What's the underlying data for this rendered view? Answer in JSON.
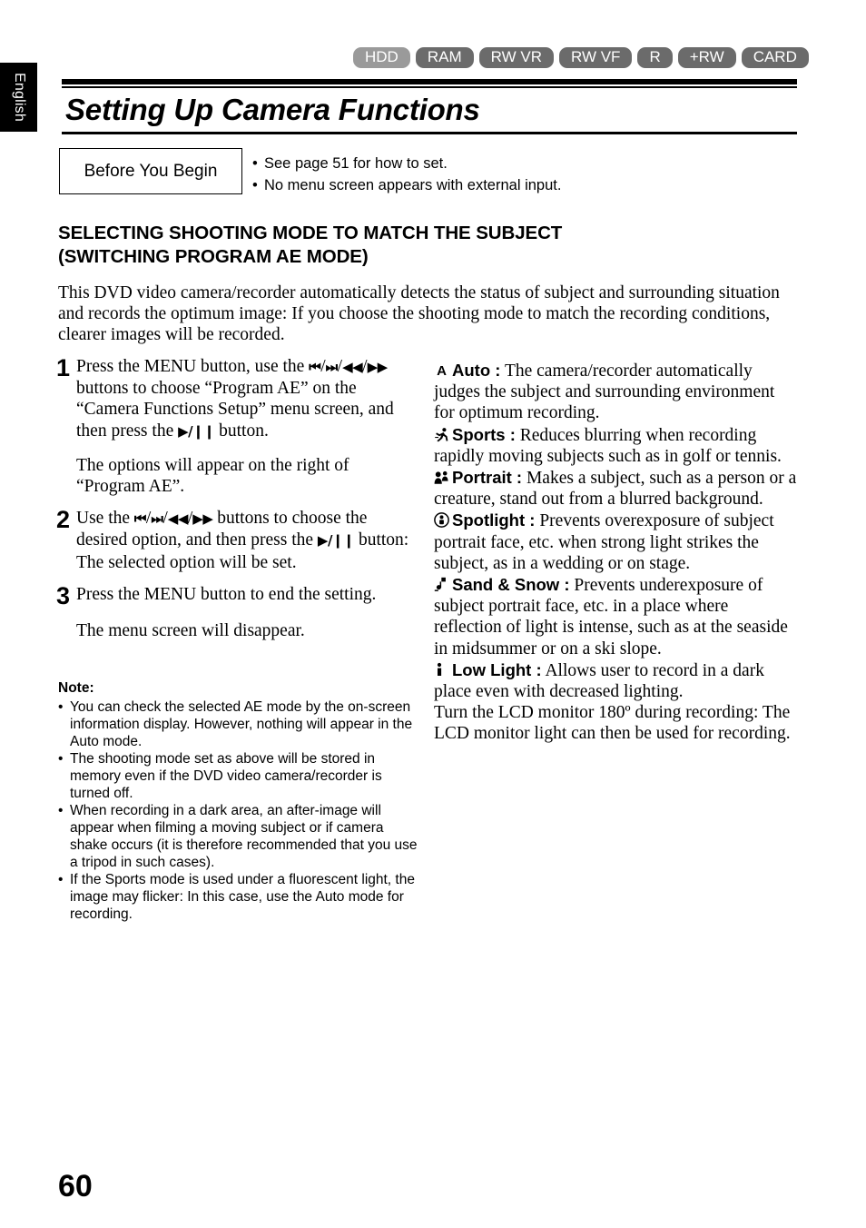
{
  "side_tab": {
    "label": "English"
  },
  "media_badges": [
    {
      "label": "HDD",
      "style": "light"
    },
    {
      "label": "RAM",
      "style": "dark"
    },
    {
      "label": "RW VR",
      "style": "dark"
    },
    {
      "label": "RW VF",
      "style": "dark"
    },
    {
      "label": "R",
      "style": "dark"
    },
    {
      "label": "+RW",
      "style": "dark"
    },
    {
      "label": "CARD",
      "style": "dark"
    }
  ],
  "title": "Setting Up Camera Functions",
  "before_you_begin": {
    "box_label": "Before You Begin",
    "bullet_char": "•",
    "items": [
      "See page 51 for how to set.",
      "No menu screen appears with external input."
    ]
  },
  "section": {
    "heading_line1": "SELECTING SHOOTING MODE TO MATCH THE SUBJECT",
    "heading_line2": "(SWITCHING PROGRAM AE MODE)",
    "intro": "This DVD video camera/recorder automatically detects the status of subject and surrounding situation and records the optimum image: If you choose the shooting mode to match the recording conditions, clearer images will be recorded."
  },
  "steps": [
    {
      "number": "1",
      "text_a": "Press the MENU button, use the ",
      "key1": "⏮",
      "sep1": "/",
      "key2": "⏭",
      "sep2": "/",
      "key3": "◀◀",
      "sep3": "/",
      "key4": "▶▶",
      "text_b": " buttons to choose “Program AE” on the “Camera Functions Setup” menu screen, and then press the ",
      "key5": "▶/❙❙",
      "text_c": " button.",
      "sub": "The options will appear on the right of “Program AE”."
    },
    {
      "number": "2",
      "text_a": "Use the ",
      "key1": "⏮",
      "sep1": "/",
      "key2": "⏭",
      "sep2": "/",
      "key3": "◀◀",
      "sep3": "/",
      "key4": "▶▶",
      "text_b": " buttons to choose the desired option, and then press the ",
      "key5": "▶/❙❙",
      "text_c": " button: The selected option will be set.",
      "sub": ""
    },
    {
      "number": "3",
      "text_a": "Press the MENU button to end the setting.",
      "sub": "The menu screen will disappear."
    }
  ],
  "note": {
    "title": "Note:",
    "bullet_char": "•",
    "items": [
      "You can check the selected AE mode by the on-screen information display. However, nothing will appear in the Auto mode.",
      "The shooting mode set as above will be stored in memory even if the DVD video camera/recorder is turned off.",
      "When recording in a dark area, an after-image will appear when filming a moving subject or if camera shake occurs (it is therefore recommended that you use a tripod in such cases).",
      "If the Sports mode is used under a fluorescent light, the image may flicker: In this case, use the Auto mode for recording."
    ]
  },
  "ae_modes": [
    {
      "icon": "auto-a-icon",
      "name": "Auto :",
      "description": " The camera/recorder automatically judges the subject and surrounding environment for optimum recording."
    },
    {
      "icon": "sports-runner-icon",
      "name": "Sports :",
      "description": " Reduces blurring when recording rapidly moving subjects such as in golf or tennis."
    },
    {
      "icon": "portrait-people-icon",
      "name": "Portrait :",
      "description": " Makes a subject, such as a person or a creature, stand out from a blurred background."
    },
    {
      "icon": "spotlight-icon",
      "name": "Spotlight :",
      "description": " Prevents overexposure of subject portrait face, etc. when strong light strikes the subject, as in a wedding or on stage."
    },
    {
      "icon": "sand-snow-icon",
      "name": "Sand & Snow :",
      "description": " Prevents underexposure of subject portrait face, etc. in a place where reflection of light is intense, such as at the seaside in midsummer or on a ski slope."
    },
    {
      "icon": "low-light-icon",
      "name": "Low Light :",
      "description": " Allows user to record in a dark place even with decreased lighting."
    }
  ],
  "ae_tail": "Turn the LCD monitor 180º during recording: The LCD monitor light can then be used for recording.",
  "page_number": "60",
  "colors": {
    "badge_dark": "#6b6b6b",
    "badge_light": "#9a9a9a",
    "text": "#000000",
    "tab_bg": "#000000"
  }
}
